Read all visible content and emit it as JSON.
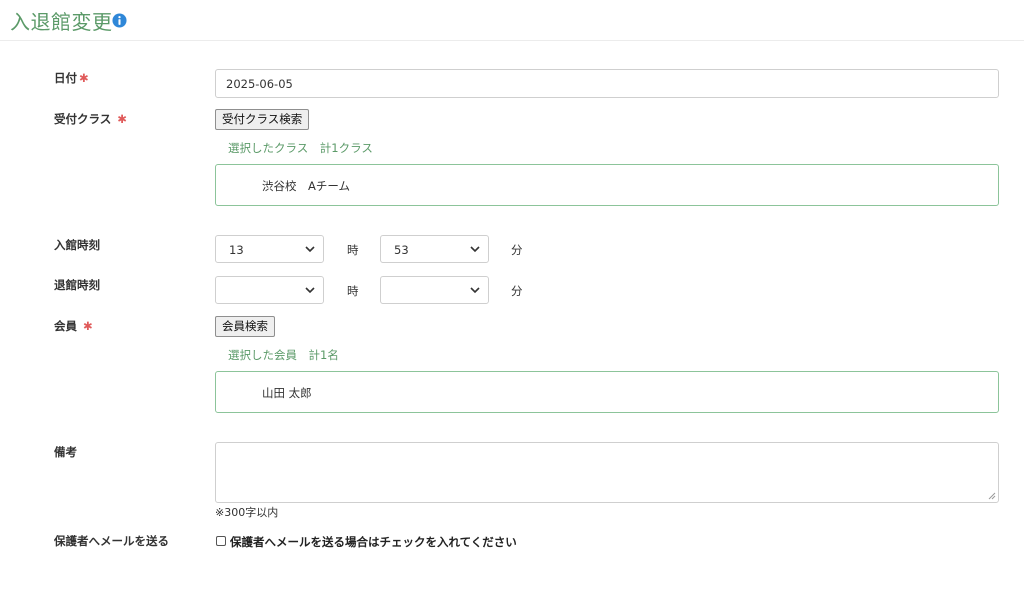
{
  "header": {
    "title": "入退館変更",
    "info_icon": "info-circle-icon",
    "title_color": "#5b9a68",
    "info_color": "#2f87d8"
  },
  "form": {
    "required_mark": "✱",
    "date": {
      "label": "日付",
      "value": "2025-06-05"
    },
    "class": {
      "label": "受付クラス",
      "search_button": "受付クラス検索",
      "selected_caption": "選択したクラス　計1クラス",
      "selected_items": [
        "渋谷校　Aチーム"
      ]
    },
    "entry_time": {
      "label": "入館時刻",
      "hour": "13",
      "hour_unit": "時",
      "minute": "53",
      "minute_unit": "分"
    },
    "exit_time": {
      "label": "退館時刻",
      "hour": "",
      "hour_unit": "時",
      "minute": "",
      "minute_unit": "分"
    },
    "member": {
      "label": "会員",
      "search_button": "会員検索",
      "selected_caption": "選択した会員　計1名",
      "selected_items": [
        "山田 太郎"
      ]
    },
    "remarks": {
      "label": "備考",
      "value": "",
      "note": "※300字以内"
    },
    "email": {
      "label": "保護者へメールを送る",
      "checkbox_label": "保護者へメールを送る場合はチェックを入れてください",
      "checked": false
    }
  },
  "colors": {
    "accent_green": "#5b9a68",
    "selected_border": "#8cc49a",
    "required": "#e05a5a"
  }
}
